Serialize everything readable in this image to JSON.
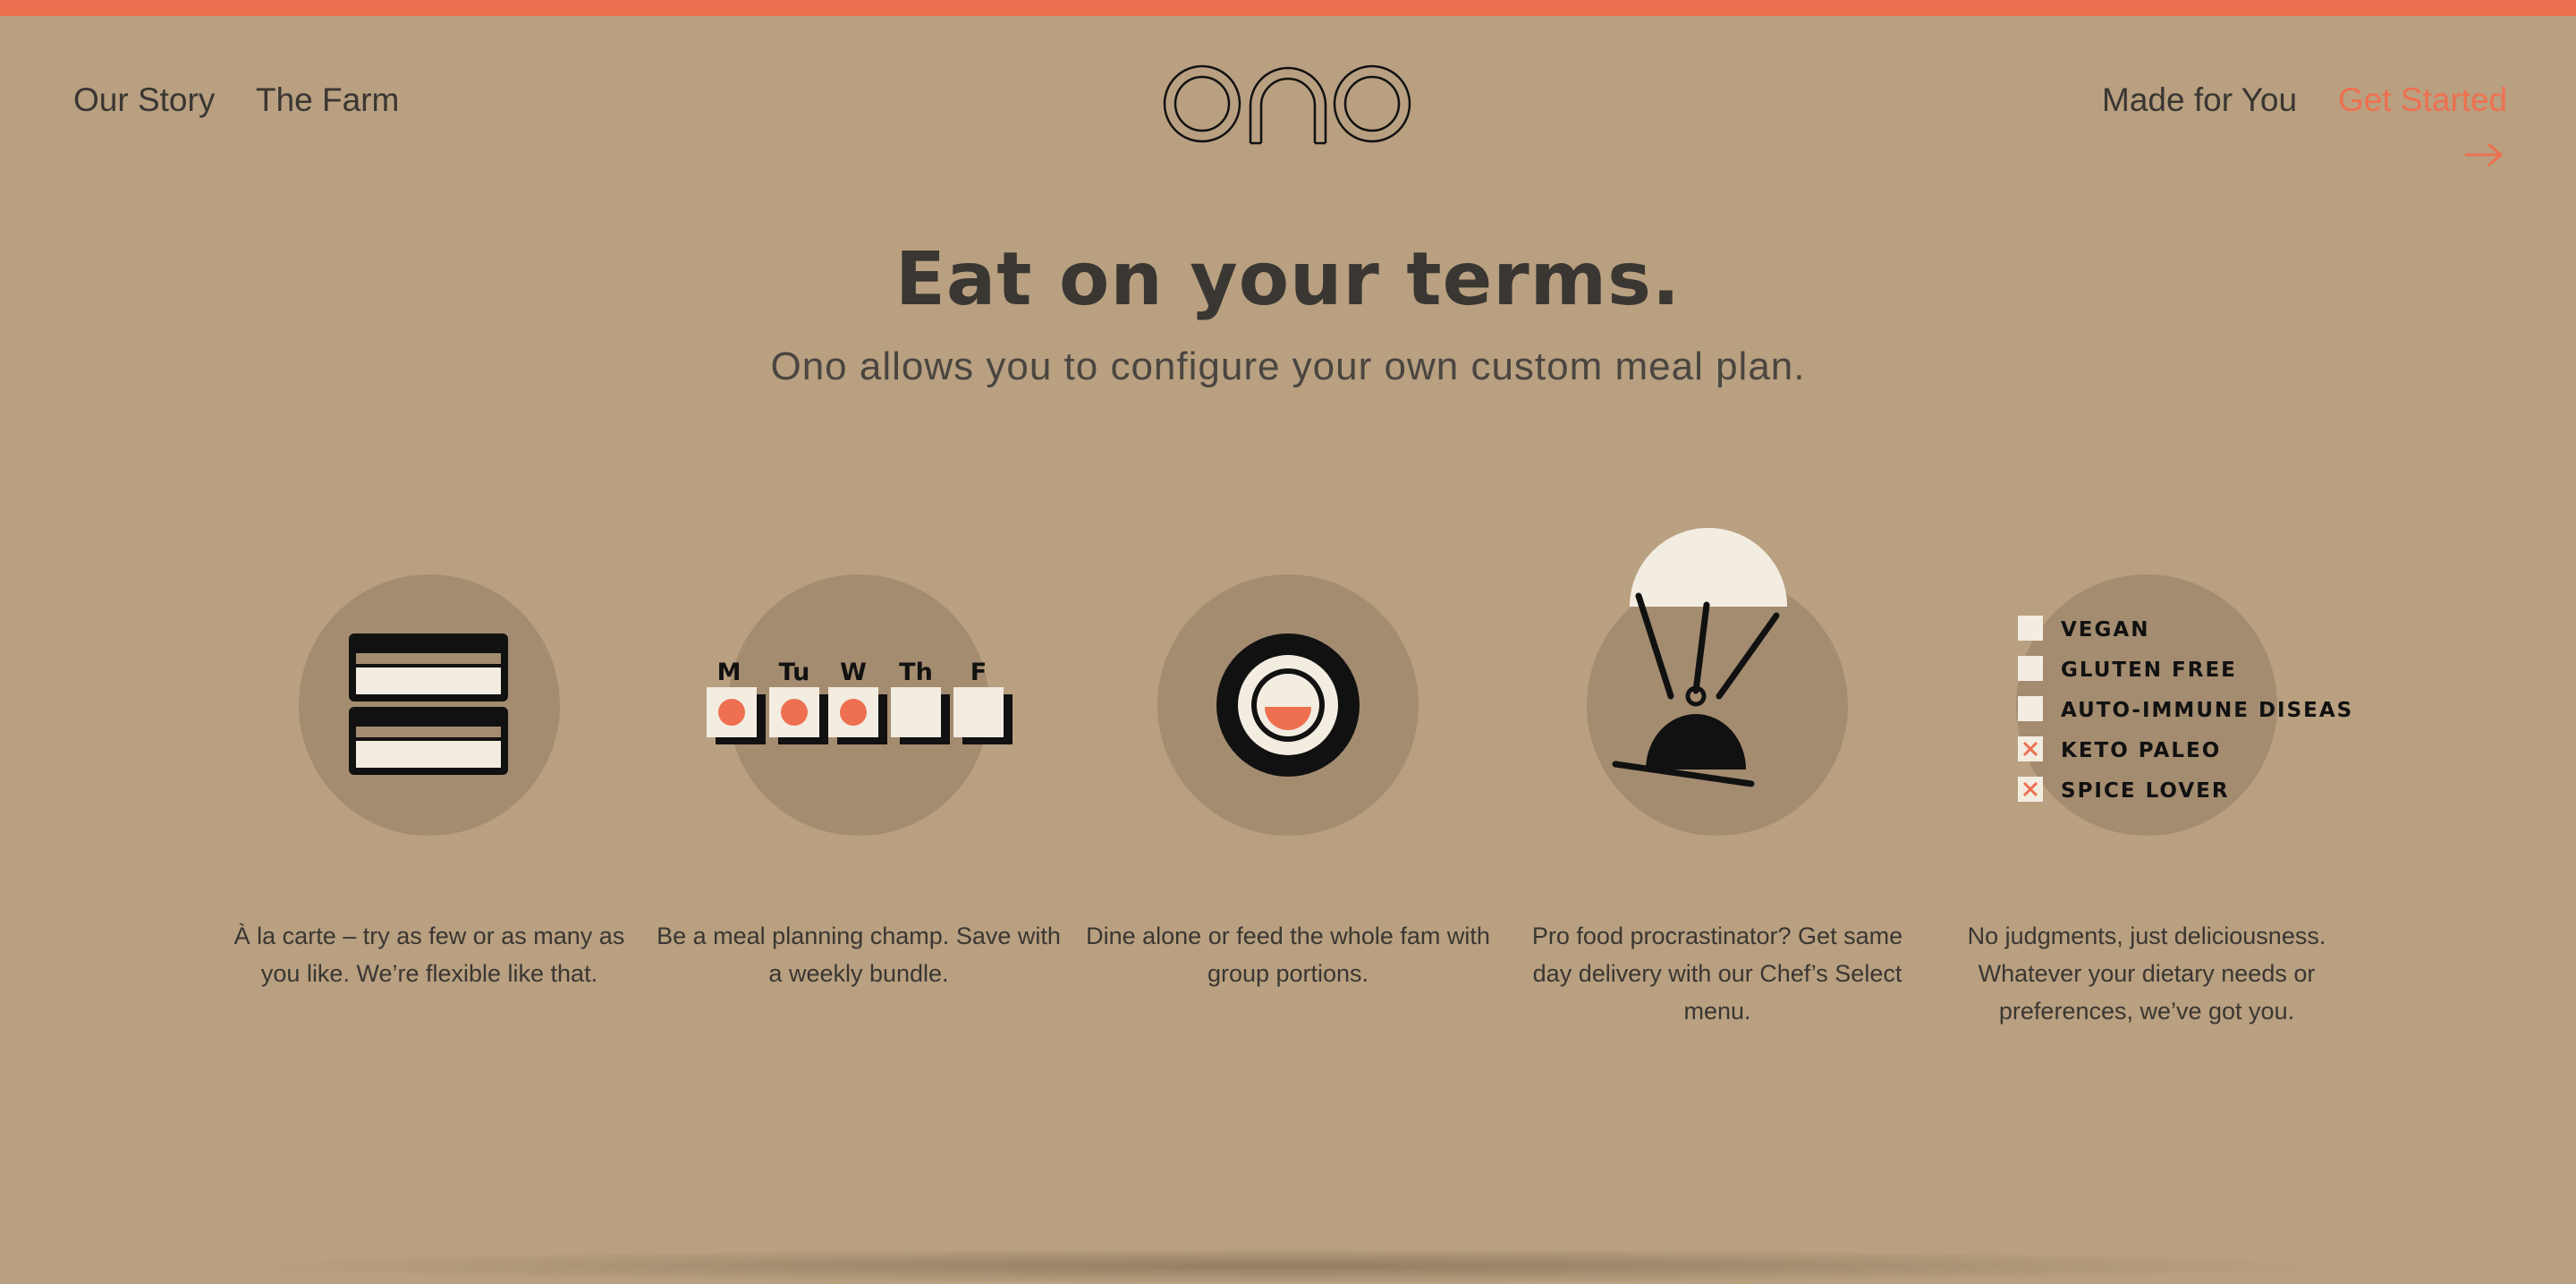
{
  "colors": {
    "background": "#b8a080",
    "accent": "#ee7050",
    "circle": "#a48c70",
    "cream": "#f3ece0",
    "ink": "#111111",
    "text": "#3a3632"
  },
  "nav": {
    "left": [
      "Our Story",
      "The Farm"
    ],
    "made_for_you": "Made for You",
    "get_started": "Get Started",
    "logo_text": "ono",
    "arrow_icon": "arrow-right-icon"
  },
  "hero": {
    "title": "Eat on your terms.",
    "subtitle": "Ono allows you to configure your own custom meal plan."
  },
  "features": [
    {
      "icon": "meal-trays-icon",
      "caption": "À la carte – try as few or as many as you like. We’re flexible like that."
    },
    {
      "icon": "weekly-calendar-icon",
      "days": [
        "M",
        "Tu",
        "W",
        "Th",
        "F"
      ],
      "checked_days": [
        true,
        true,
        true,
        false,
        false
      ],
      "caption": "Be a meal planning champ. Save with a weekly bundle."
    },
    {
      "icon": "bowl-icon",
      "caption": "Dine alone or feed the whole fam with group portions."
    },
    {
      "icon": "parachute-cloche-icon",
      "caption": "Pro food procrastinator? Get same day delivery with our Chef’s Select menu."
    },
    {
      "icon": "dietary-checklist-icon",
      "options": [
        {
          "label": "VEGAN",
          "checked": false
        },
        {
          "label": "GLUTEN FREE",
          "checked": false
        },
        {
          "label": "AUTO-IMMUNE DISEASE",
          "checked": false
        },
        {
          "label": "KETO PALEO",
          "checked": true
        },
        {
          "label": "SPICE LOVER",
          "checked": true
        }
      ],
      "caption": "No judgments, just deliciousness. Whatever your dietary needs or preferences, we’ve got you."
    }
  ]
}
